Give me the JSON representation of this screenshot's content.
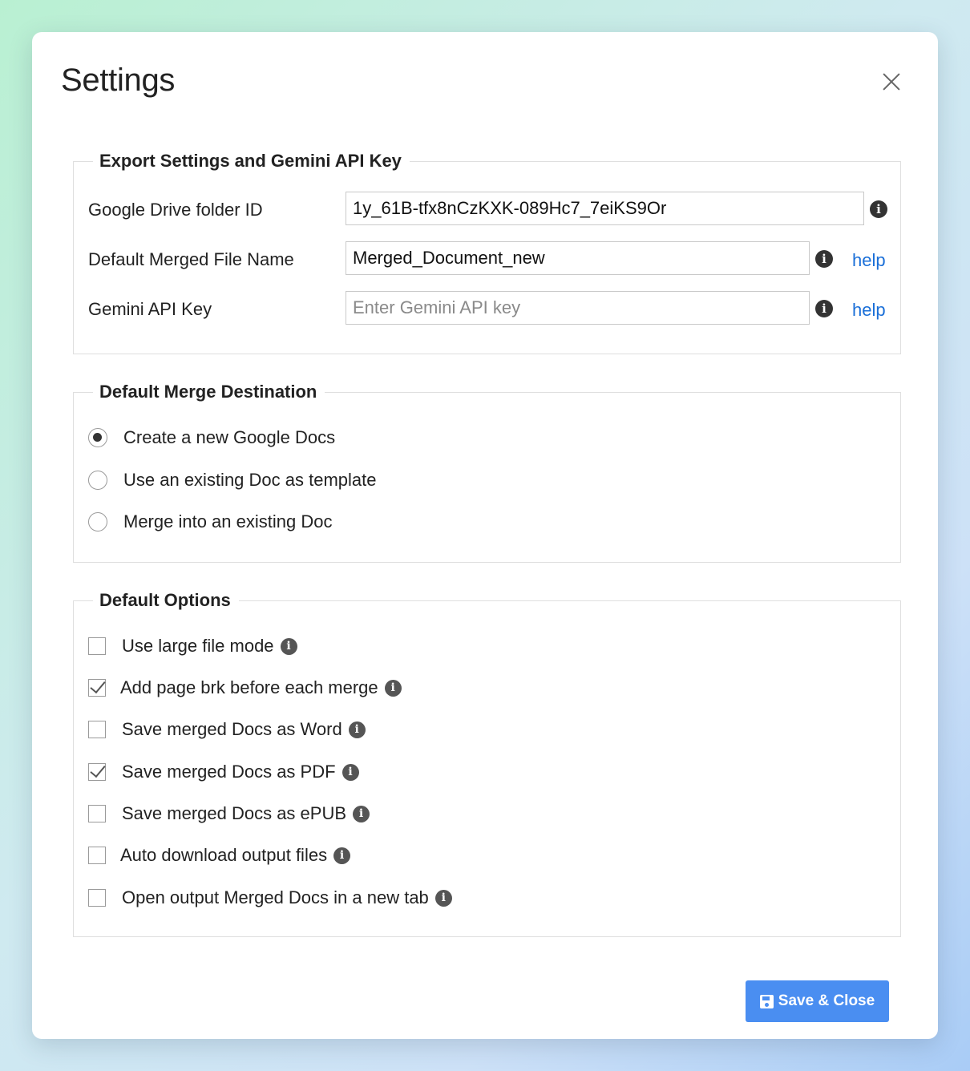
{
  "dialog": {
    "title": "Settings",
    "close_icon": "close-icon"
  },
  "export_settings": {
    "legend": "Export Settings and Gemini API Key",
    "folder_id": {
      "label": "Google Drive folder ID",
      "value": "1y_61B-tfx8nCzKXK-089Hc7_7eiKS9Or"
    },
    "merged_file_name": {
      "label": "Default Merged File Name",
      "value": "Merged_Document_new",
      "help": "help"
    },
    "api_key": {
      "label": "Gemini API Key",
      "value": "",
      "placeholder": "Enter Gemini API key",
      "help": "help"
    }
  },
  "merge_destination": {
    "legend": "Default Merge Destination",
    "options": [
      {
        "label": "Create a new Google Docs",
        "selected": true
      },
      {
        "label": "Use an existing Doc as template",
        "selected": false
      },
      {
        "label": "Merge into an existing Doc",
        "selected": false
      }
    ]
  },
  "default_options": {
    "legend": "Default Options",
    "options": [
      {
        "label": "Use large file mode",
        "checked": false
      },
      {
        "label": "Add page brk before each merge",
        "checked": true
      },
      {
        "label": "Save merged Docs as Word",
        "checked": false
      },
      {
        "label": "Save merged Docs as PDF",
        "checked": true
      },
      {
        "label": "Save merged Docs as ePUB",
        "checked": false
      },
      {
        "label": "Auto download output files",
        "checked": false
      },
      {
        "label": "Open output Merged Docs in a new tab",
        "checked": false
      }
    ]
  },
  "footer": {
    "save_label": "Save & Close",
    "save_icon": "floppy-disk-icon"
  },
  "info_glyph": "i",
  "colors": {
    "primary_button": "#4a8ef1",
    "link": "#1a6fd8"
  }
}
